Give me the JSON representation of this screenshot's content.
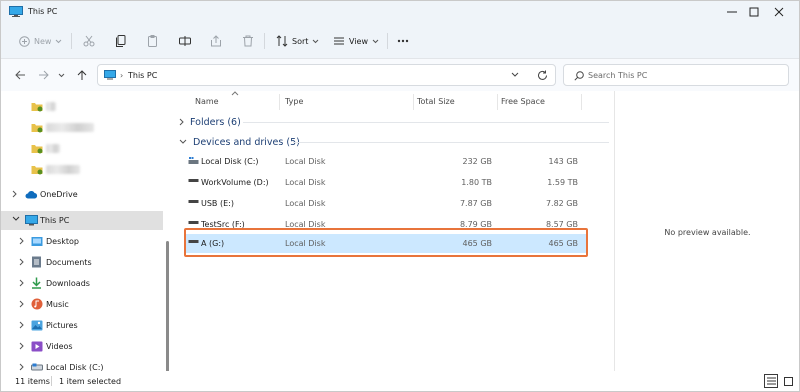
{
  "window": {
    "title": "This PC"
  },
  "toolbar": {
    "new_label": "New",
    "sort_label": "Sort",
    "view_label": "View"
  },
  "address": {
    "crumb": "This PC"
  },
  "search": {
    "placeholder": "Search This PC"
  },
  "sidebar": {
    "items": [
      {
        "label": "OneDrive",
        "icon": "cloud-icon"
      },
      {
        "label": "This PC",
        "icon": "computer-icon"
      },
      {
        "label": "Desktop",
        "icon": "desktop-folder-icon"
      },
      {
        "label": "Documents",
        "icon": "documents-folder-icon"
      },
      {
        "label": "Downloads",
        "icon": "downloads-folder-icon"
      },
      {
        "label": "Music",
        "icon": "music-folder-icon"
      },
      {
        "label": "Pictures",
        "icon": "pictures-folder-icon"
      },
      {
        "label": "Videos",
        "icon": "videos-folder-icon"
      },
      {
        "label": "Local Disk (C:)",
        "icon": "drive-icon"
      }
    ]
  },
  "list": {
    "columns": {
      "name": "Name",
      "type": "Type",
      "total": "Total Size",
      "free": "Free Space"
    },
    "folders_group": "Folders (6)",
    "drives_group": "Devices and drives (5)",
    "drives": [
      {
        "name": "Local Disk (C:)",
        "type": "Local Disk",
        "total": "232 GB",
        "free": "143 GB"
      },
      {
        "name": "WorkVolume (D:)",
        "type": "Local Disk",
        "total": "1.80 TB",
        "free": "1.59 TB"
      },
      {
        "name": "USB (E:)",
        "type": "Local Disk",
        "total": "7.87 GB",
        "free": "7.82 GB"
      },
      {
        "name": "TestSrc (F:)",
        "type": "Local Disk",
        "total": "8.79 GB",
        "free": "8.57 GB"
      },
      {
        "name": "A (G:)",
        "type": "Local Disk",
        "total": "465 GB",
        "free": "465 GB"
      }
    ]
  },
  "preview": {
    "text": "No preview available."
  },
  "status": {
    "item_count": "11 items",
    "selected": "1 item selected"
  },
  "colors": {
    "accent": "#0067c0",
    "selection": "#cce8ff",
    "highlight_border": "#e8743b"
  }
}
